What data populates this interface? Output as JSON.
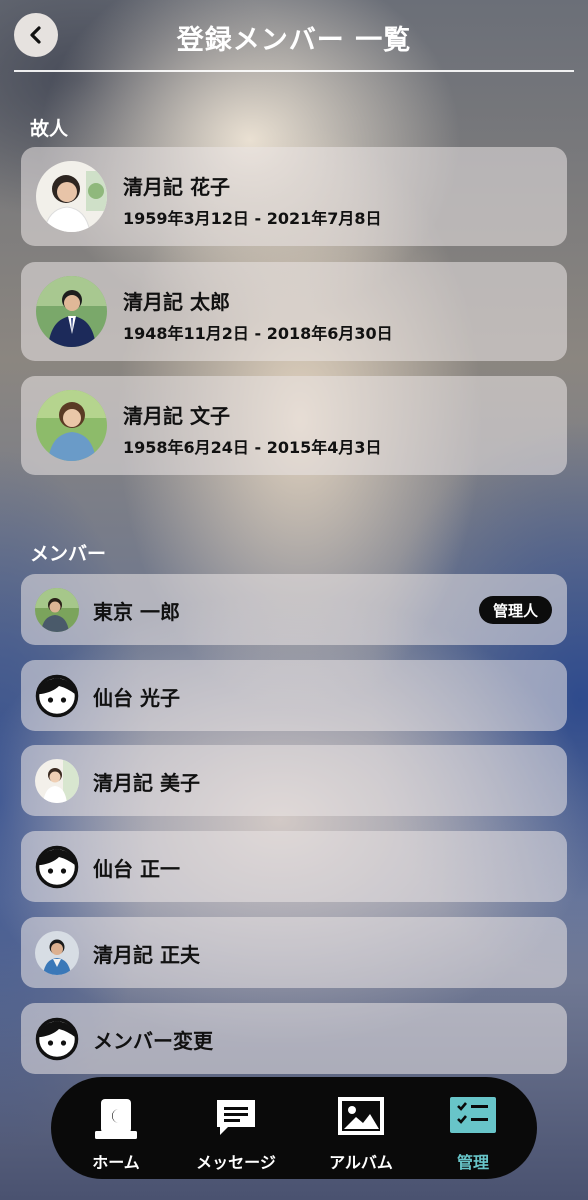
{
  "header": {
    "title": "登録メンバー 一覧"
  },
  "deceased": {
    "label": "故人",
    "items": [
      {
        "name": "清月記 花子",
        "dates": "1959年3月12日 - 2021年7月8日"
      },
      {
        "name": "清月記 太郎",
        "dates": "1948年11月2日 - 2018年6月30日"
      },
      {
        "name": "清月記 文子",
        "dates": "1958年6月24日 - 2015年4月3日"
      }
    ]
  },
  "members": {
    "label": "メンバー",
    "items": [
      {
        "name": "東京 一郎",
        "badge": "管理人",
        "avatar": "photo"
      },
      {
        "name": "仙台 光子",
        "avatar": "face-icon"
      },
      {
        "name": "清月記 美子",
        "avatar": "photo"
      },
      {
        "name": "仙台 正一",
        "avatar": "face-icon"
      },
      {
        "name": "清月記 正夫",
        "avatar": "photo"
      },
      {
        "name": "メンバー変更",
        "avatar": "face-icon"
      }
    ]
  },
  "nav": {
    "items": [
      {
        "label": "ホーム",
        "icon": "gravestone-icon"
      },
      {
        "label": "メッセージ",
        "icon": "message-icon"
      },
      {
        "label": "アルバム",
        "icon": "image-icon"
      },
      {
        "label": "管理",
        "icon": "checklist-icon",
        "active": true
      }
    ],
    "active_color": "#68c5c9"
  }
}
